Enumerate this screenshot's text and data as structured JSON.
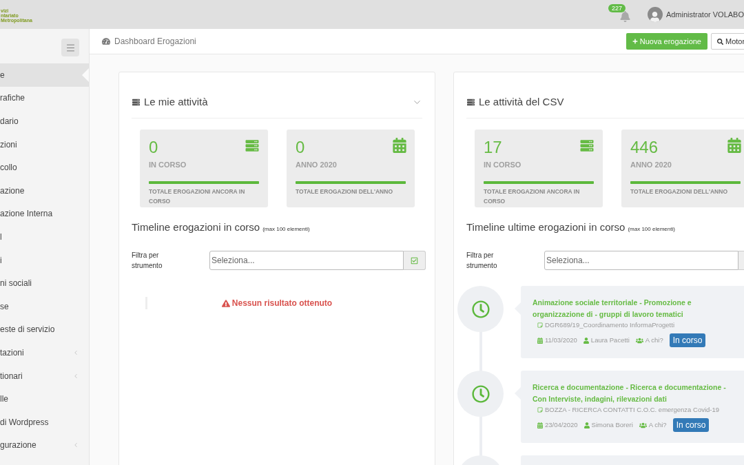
{
  "topbar": {
    "logo_lines": [
      "vizi",
      "ntariato",
      "Metropolitana"
    ],
    "notifications": "227",
    "user": "Administrator VOLABO"
  },
  "sidebar": {
    "items": [
      {
        "label": "e",
        "kind": "link",
        "selected": true
      },
      {
        "label": "rafiche",
        "kind": "link",
        "selected": false
      },
      {
        "label": "dario",
        "kind": "link",
        "selected": false
      },
      {
        "label": "zioni",
        "kind": "link",
        "selected": false
      },
      {
        "label": "collo",
        "kind": "link",
        "selected": false
      },
      {
        "label": "azione",
        "kind": "link",
        "selected": false
      },
      {
        "label": "azione Interna",
        "kind": "link",
        "selected": false
      },
      {
        "label": "l",
        "kind": "link",
        "selected": false
      },
      {
        "label": "i",
        "kind": "link",
        "selected": false
      },
      {
        "label": "ni sociali",
        "kind": "link",
        "selected": false
      },
      {
        "label": "se",
        "kind": "link",
        "selected": false
      },
      {
        "label": "este di servizio",
        "kind": "link",
        "selected": false
      },
      {
        "label": "tazioni",
        "kind": "group",
        "selected": false
      },
      {
        "label": "tionari",
        "kind": "group",
        "selected": false
      },
      {
        "label": "lle",
        "kind": "link",
        "selected": false
      },
      {
        "label": "di Wordpress",
        "kind": "link",
        "selected": false
      },
      {
        "label": "gurazione",
        "kind": "group",
        "selected": false
      }
    ]
  },
  "header": {
    "title": "Dashboard Erogazioni",
    "buttons": [
      {
        "label": "Nuova erogazione",
        "kind": "add"
      },
      {
        "label": "Motor",
        "kind": "search"
      }
    ]
  },
  "panels": [
    {
      "title": "Le mie attività",
      "expanded": true,
      "stats": [
        {
          "kind": "ongoing",
          "value": "0",
          "label": "IN CORSO",
          "level": 1,
          "description": "TOTALE EROGAZIONI ANCORA IN CORSO"
        },
        {
          "kind": "annual",
          "value": "0",
          "label": "ANNO 2020",
          "level": 1,
          "description": "TOTALE EROGAZIONI DELL'ANNO"
        }
      ],
      "timeline": {
        "title": "Timeline erogazioni in corso",
        "note": "(max 100 elementi)",
        "filter": {
          "label": "Filtra per strumento",
          "placeholder": "Seleziona..."
        },
        "empty_message": "Nessun risultato ottenuto"
      }
    },
    {
      "title": "Le attività del CSV",
      "stats": [
        {
          "kind": "ongoing",
          "value": "17",
          "label": "IN CORSO",
          "level": 1,
          "description": "TOTALE EROGAZIONI ANCORA IN CORSO"
        },
        {
          "kind": "annual",
          "value": "446",
          "label": "ANNO 2020",
          "level": 1,
          "description": "TOTALE EROGAZIONI DELL'ANNO"
        }
      ],
      "timeline": {
        "title": "Timeline ultime erogazioni in corso",
        "note": "(max 100 elementi)",
        "filter": {
          "label": "Filtra per strumento",
          "placeholder": "Seleziona..."
        },
        "items": [
          {
            "title": "Animazione sociale territoriale - Promozione e organizzazione di - gruppi di lavoro tematici",
            "subtitle": "DGR689/19_Coordinamento InformaProgetti",
            "date": "11/03/2020",
            "author": "Laura Pacetti",
            "recipients": "A chi?",
            "status": "In corso"
          },
          {
            "title": "Ricerca e documentazione - Ricerca e documentazione - Con Interviste, indagini, rilevazioni dati",
            "subtitle": "BOZZA - RICERCA CONTATTI C.O.C. emergenza Covid-19",
            "date": "23/04/2020",
            "author": "Simona Boreri",
            "recipients": "A chi?",
            "status": "In corso"
          }
        ],
        "more_below": true
      }
    }
  ]
}
